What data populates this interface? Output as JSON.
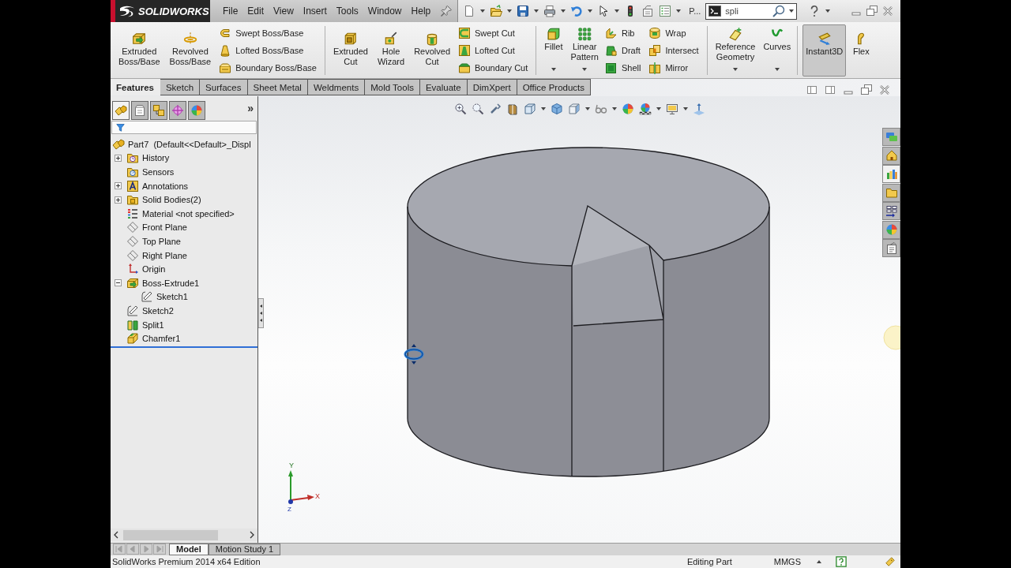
{
  "title_bar": {
    "logo": "SOLIDWORKS",
    "menu": [
      "File",
      "Edit",
      "View",
      "Insert",
      "Tools",
      "Window",
      "Help"
    ],
    "truncated_label": "P...",
    "search": {
      "value": "spli"
    }
  },
  "ribbon": [
    [
      {
        "label": "Extruded Boss/Base",
        "dropdown": false
      },
      {
        "label": "Revolved Boss/Base",
        "dropdown": false
      },
      {
        "stack": [
          {
            "label": "Swept Boss/Base"
          },
          {
            "label": "Lofted Boss/Base"
          },
          {
            "label": "Boundary Boss/Base"
          }
        ]
      }
    ],
    [
      {
        "label": "Extruded Cut",
        "dropdown": false
      },
      {
        "label": "Hole Wizard",
        "dropdown": false
      },
      {
        "label": "Revolved Cut",
        "dropdown": false
      },
      {
        "stack": [
          {
            "label": "Swept Cut"
          },
          {
            "label": "Lofted Cut"
          },
          {
            "label": "Boundary Cut"
          }
        ]
      }
    ],
    [
      {
        "label": "Fillet",
        "dropdown": true
      },
      {
        "label": "Linear Pattern",
        "dropdown": true
      },
      {
        "stack": [
          {
            "label": "Rib"
          },
          {
            "label": "Draft"
          },
          {
            "label": "Shell"
          }
        ]
      },
      {
        "stack": [
          {
            "label": "Wrap"
          },
          {
            "label": "Intersect"
          },
          {
            "label": "Mirror"
          }
        ]
      }
    ],
    [
      {
        "label": "Reference Geometry",
        "dropdown": true
      },
      {
        "label": "Curves",
        "dropdown": true
      }
    ],
    [
      {
        "label": "Instant3D",
        "dropdown": false,
        "on": true
      },
      {
        "label": "Flex",
        "dropdown": false,
        "on": false
      }
    ]
  ],
  "tabs": [
    {
      "label": "Features",
      "selected": true
    },
    {
      "label": "Sketch",
      "selected": false
    },
    {
      "label": "Surfaces",
      "selected": false
    },
    {
      "label": "Sheet Metal",
      "selected": false
    },
    {
      "label": "Weldments",
      "selected": false
    },
    {
      "label": "Mold Tools",
      "selected": false
    },
    {
      "label": "Evaluate",
      "selected": false
    },
    {
      "label": "DimXpert",
      "selected": false
    },
    {
      "label": "Office Products",
      "selected": false
    }
  ],
  "feature_manager": {
    "tabs": [
      {
        "selected": true
      },
      {
        "selected": false
      },
      {
        "selected": false
      },
      {
        "selected": false
      },
      {
        "selected": false
      }
    ],
    "more": "»",
    "tree": {
      "label": "Part7  (Default<<Default>_Displ",
      "kind": "part",
      "children": [
        {
          "label": "History",
          "kind": "history",
          "expanded": false
        },
        {
          "label": "Sensors",
          "kind": "sensors"
        },
        {
          "label": "Annotations",
          "kind": "annotations",
          "expanded": false
        },
        {
          "label": "Solid Bodies(2)",
          "kind": "bodies",
          "expanded": false
        },
        {
          "label": "Material <not specified>",
          "kind": "material"
        },
        {
          "label": "Front Plane",
          "kind": "plane"
        },
        {
          "label": "Top Plane",
          "kind": "plane"
        },
        {
          "label": "Right Plane",
          "kind": "plane"
        },
        {
          "label": "Origin",
          "kind": "origin"
        },
        {
          "label": "Boss-Extrude1",
          "kind": "extrude",
          "expanded": true,
          "children": [
            {
              "label": "Sketch1",
              "kind": "sketch"
            }
          ]
        },
        {
          "label": "Sketch2",
          "kind": "sketch"
        },
        {
          "label": "Split1",
          "kind": "split"
        },
        {
          "label": "Chamfer1",
          "kind": "chamfer"
        }
      ]
    }
  },
  "task_pane": [
    {
      "selected": false
    },
    {
      "selected": false
    },
    {
      "selected": true
    },
    {
      "selected": false
    },
    {
      "selected": false
    },
    {
      "selected": false
    },
    {
      "selected": false
    }
  ],
  "triad": {
    "x": "X",
    "y": "Y",
    "z": "Z"
  },
  "sheet_tabs": [
    {
      "label": "Model",
      "selected": true
    },
    {
      "label": "Motion Study 1",
      "selected": false
    }
  ],
  "status_bar": {
    "product": "SolidWorks Premium 2014 x64 Edition",
    "mode": "Editing Part",
    "units": "MMGS"
  }
}
